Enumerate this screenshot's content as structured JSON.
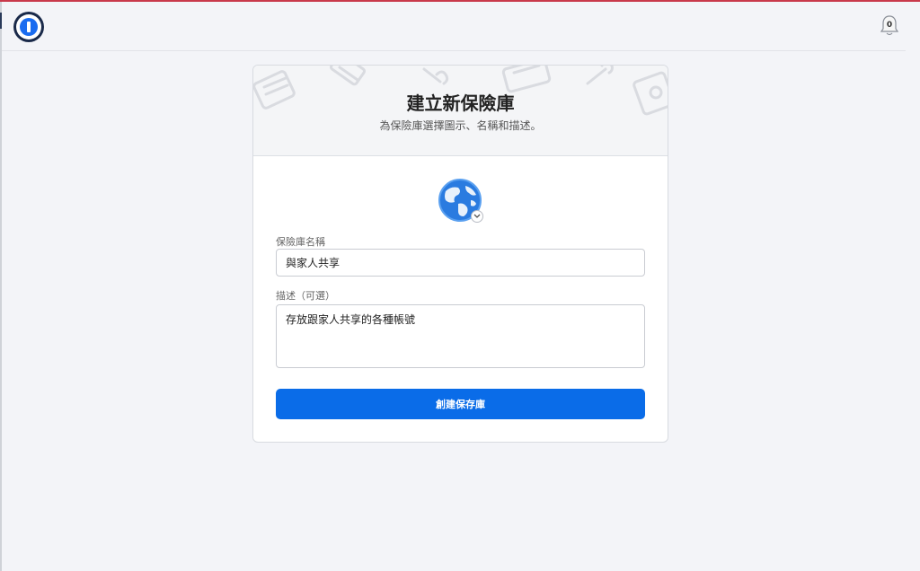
{
  "app": {
    "logo_icon": "1password-logo-icon",
    "notifications": {
      "icon": "bell-icon",
      "count": "0"
    }
  },
  "dialog": {
    "title": "建立新保險庫",
    "subtitle": "為保險庫選擇圖示、名稱和描述。",
    "vault_icon": "globe-icon",
    "name_label": "保險庫名稱",
    "name_value": "與家人共享",
    "description_label": "描述（可選）",
    "description_value": "存放跟家人共享的各種帳號",
    "create_button": "創建保存庫"
  },
  "colors": {
    "accent": "#0a6ce8",
    "top_bar_accent": "#c9394b",
    "page_background": "#f3f4f8"
  }
}
